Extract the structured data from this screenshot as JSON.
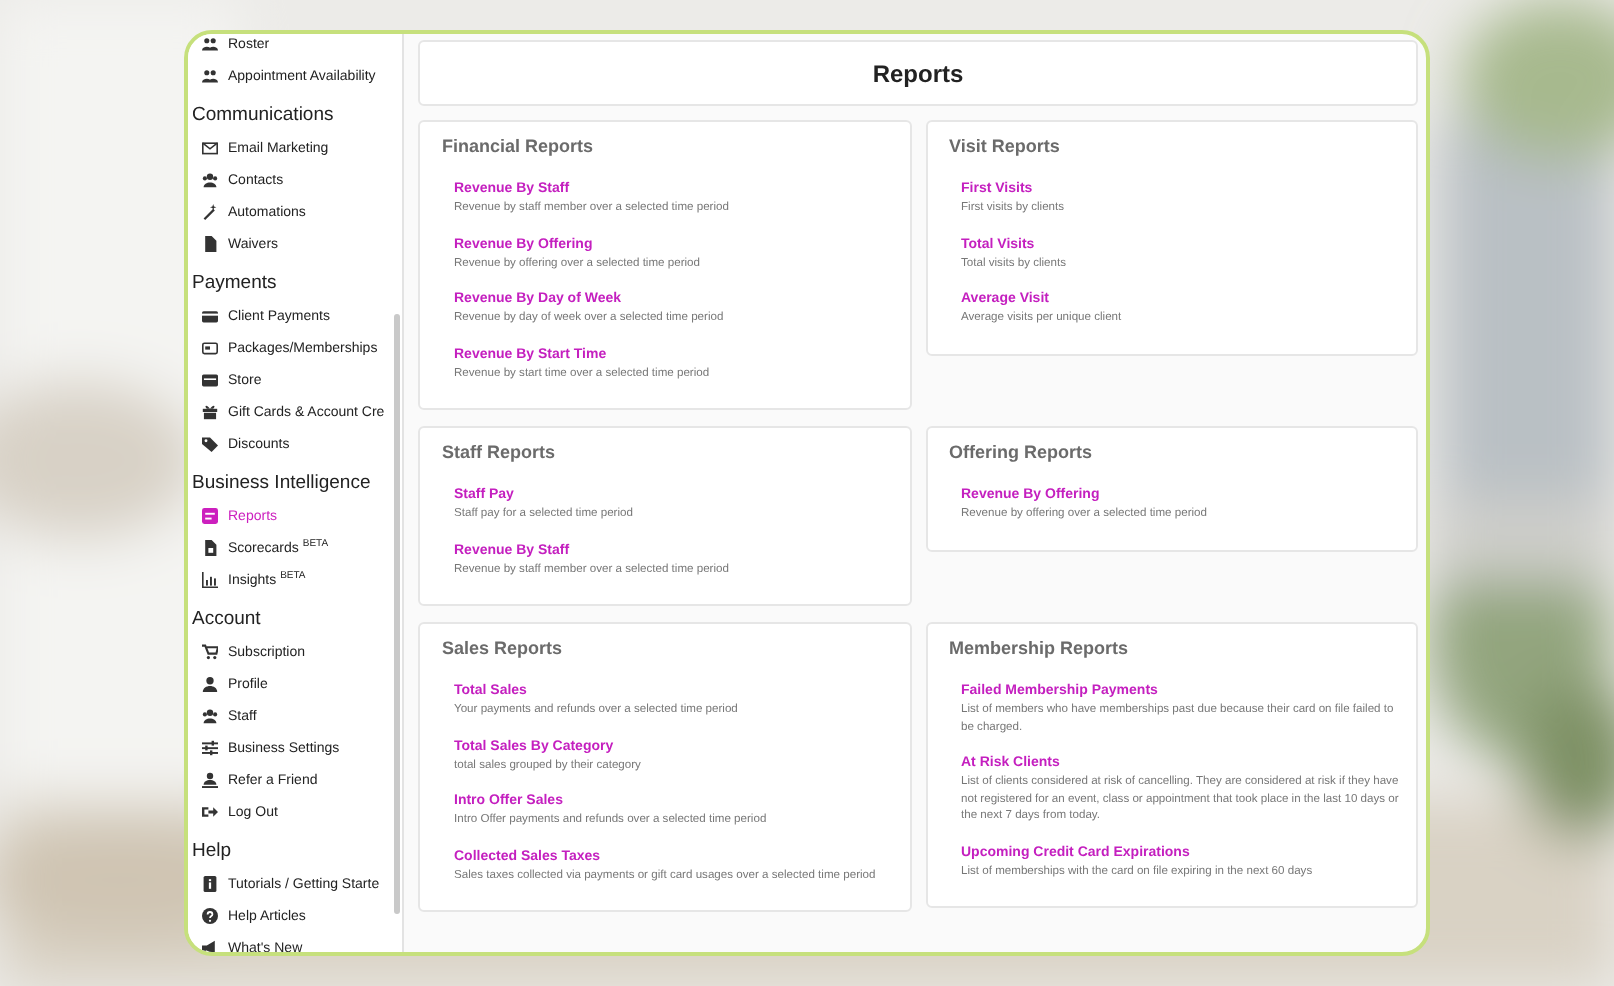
{
  "sidebar": {
    "sections": [
      {
        "items": [
          {
            "label": "Roster",
            "selected": false
          },
          {
            "label": "Appointment Availability",
            "selected": false
          }
        ]
      },
      {
        "title": "Communications",
        "items": [
          {
            "label": "Email Marketing",
            "selected": false
          },
          {
            "label": "Contacts",
            "selected": false
          },
          {
            "label": "Automations",
            "selected": false
          },
          {
            "label": "Waivers",
            "selected": false
          }
        ]
      },
      {
        "title": "Payments",
        "items": [
          {
            "label": "Client Payments",
            "selected": false
          },
          {
            "label": "Packages/Memberships",
            "selected": false
          },
          {
            "label": "Store",
            "selected": false
          },
          {
            "label": "Gift Cards & Account Cre",
            "selected": false
          },
          {
            "label": "Discounts",
            "selected": false
          }
        ]
      },
      {
        "title": "Business Intelligence",
        "items": [
          {
            "label": "Reports",
            "selected": true
          },
          {
            "label": "Scorecards $^{BETA}$",
            "selected": false
          },
          {
            "label": "Insights $^{BETA}$",
            "selected": false
          }
        ]
      },
      {
        "title": "Account",
        "items": [
          {
            "label": "Subscription",
            "selected": false
          },
          {
            "label": "Profile",
            "selected": false
          },
          {
            "label": "Staff",
            "selected": false
          },
          {
            "label": "Business Settings",
            "selected": false
          },
          {
            "label": "Refer a Friend",
            "selected": false
          },
          {
            "label": "Log Out",
            "selected": false
          }
        ]
      },
      {
        "title": "Help",
        "items": [
          {
            "label": "Tutorials / Getting Starte",
            "selected": false
          },
          {
            "label": "Help Articles",
            "selected": false
          },
          {
            "label": "What's New",
            "selected": false
          }
        ]
      }
    ]
  },
  "page_title": "Reports",
  "columns": [
    [
      {
        "title": "Financial Reports",
        "reports": [
          {
            "name": "Revenue By Staff",
            "description": "Revenue by staff member over a selected time period"
          },
          {
            "name": "Revenue By Offering",
            "description": "Revenue by offering over a selected time period"
          },
          {
            "name": "Revenue By Day of Week",
            "description": "Revenue by day of week over a selected time period"
          },
          {
            "name": "Revenue By Start Time",
            "description": "Revenue by start time over a selected time period"
          }
        ]
      },
      {
        "title": "Visit Reports",
        "reports": [
          {
            "name": "First Visits",
            "description": "First visits by clients"
          },
          {
            "name": "Total Visits",
            "description": "Total visits by clients"
          },
          {
            "name": "Average Visit",
            "description": "Average visits per unique client"
          }
        ]
      }
    ],
    [
      {
        "title": "Staff Reports",
        "reports": [
          {
            "name": "Staff Pay",
            "description": "Staff pay for a selected time period"
          },
          {
            "name": "Revenue By Staff",
            "description": "Revenue by staff member over a selected time period"
          }
        ]
      },
      {
        "title": "Offering Reports",
        "reports": [
          {
            "name": "Revenue By Offering",
            "description": "Revenue by offering over a selected time period"
          }
        ]
      }
    ],
    [
      {
        "title": "Sales Reports",
        "reports": [
          {
            "name": "Total Sales",
            "description": "Your payments and refunds over a selected time period"
          },
          {
            "name": "Total Sales By Category",
            "description": "total sales grouped by their category"
          },
          {
            "name": "Intro Offer Sales",
            "description": "Intro Offer payments and refunds over a selected time period"
          },
          {
            "name": "Collected Sales Taxes",
            "description": "Sales taxes collected via payments or gift card usages over a selected time period"
          }
        ]
      },
      {
        "title": "Membership Reports",
        "reports": [
          {
            "name": "Failed Membership Payments",
            "description": "List of members who have memberships past due because their card on file failed to be charged."
          },
          {
            "name": "At Risk Clients",
            "description": "List of clients considered at risk of cancelling. They are considered at risk if they have not registered for an event, class or appointment that took place in the last 10 days or the next 7 days from today."
          },
          {
            "name": "Upcoming Credit Card Expirations",
            "description": "List of memberships with the card on file expiring in the next 60 days"
          }
        ]
      }
    ]
  ]
}
